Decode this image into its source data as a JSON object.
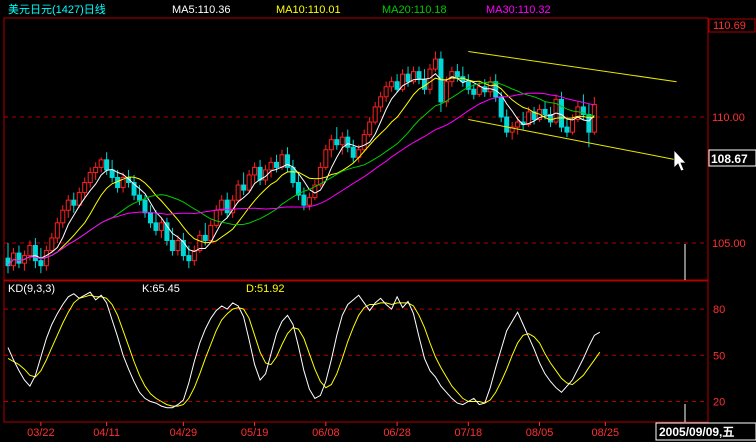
{
  "chart_data": {
    "type": "candlestick",
    "instrument": "美元日元(1427)日线",
    "moving_averages": [
      {
        "name": "MA5",
        "label": "MA5:110.36",
        "color": "#ffffff"
      },
      {
        "name": "MA10",
        "label": "MA10:110.01",
        "color": "#ffff00"
      },
      {
        "name": "MA20",
        "label": "MA20:110.18",
        "color": "#00cc00"
      },
      {
        "name": "MA30",
        "label": "MA30:110.32",
        "color": "#ff00ff"
      }
    ],
    "price_axis": {
      "range": [
        103.2,
        111.2
      ],
      "ticks": [
        "105.00",
        "110.00"
      ],
      "tick_values": [
        105,
        110
      ],
      "max_label": "110.69",
      "current_label": "108.67"
    },
    "candles": [
      {
        "o": 104.4,
        "h": 105.0,
        "l": 103.8,
        "c": 104.1
      },
      {
        "o": 104.1,
        "h": 104.8,
        "l": 103.9,
        "c": 104.6
      },
      {
        "o": 104.6,
        "h": 104.9,
        "l": 104.0,
        "c": 104.2
      },
      {
        "o": 104.2,
        "h": 104.7,
        "l": 103.9,
        "c": 104.5
      },
      {
        "o": 104.5,
        "h": 105.1,
        "l": 104.3,
        "c": 104.9
      },
      {
        "o": 104.9,
        "h": 105.2,
        "l": 104.0,
        "c": 104.3
      },
      {
        "o": 104.3,
        "h": 104.8,
        "l": 103.8,
        "c": 104.1
      },
      {
        "o": 104.1,
        "h": 104.9,
        "l": 103.9,
        "c": 104.7
      },
      {
        "o": 104.7,
        "h": 105.4,
        "l": 104.6,
        "c": 105.2
      },
      {
        "o": 105.2,
        "h": 106.0,
        "l": 105.0,
        "c": 105.8
      },
      {
        "o": 105.8,
        "h": 106.5,
        "l": 105.6,
        "c": 106.3
      },
      {
        "o": 106.3,
        "h": 106.9,
        "l": 106.0,
        "c": 106.7
      },
      {
        "o": 106.7,
        "h": 107.0,
        "l": 106.2,
        "c": 106.5
      },
      {
        "o": 106.5,
        "h": 107.2,
        "l": 106.4,
        "c": 107.0
      },
      {
        "o": 107.0,
        "h": 107.6,
        "l": 106.8,
        "c": 107.4
      },
      {
        "o": 107.4,
        "h": 108.0,
        "l": 107.2,
        "c": 107.8
      },
      {
        "o": 107.8,
        "h": 108.2,
        "l": 107.5,
        "c": 108.0
      },
      {
        "o": 108.0,
        "h": 108.4,
        "l": 107.8,
        "c": 108.3
      },
      {
        "o": 108.3,
        "h": 108.6,
        "l": 107.7,
        "c": 107.9
      },
      {
        "o": 107.9,
        "h": 108.3,
        "l": 107.4,
        "c": 107.6
      },
      {
        "o": 107.6,
        "h": 107.9,
        "l": 107.0,
        "c": 107.2
      },
      {
        "o": 107.2,
        "h": 107.8,
        "l": 107.0,
        "c": 107.6
      },
      {
        "o": 107.6,
        "h": 107.9,
        "l": 107.2,
        "c": 107.4
      },
      {
        "o": 107.4,
        "h": 107.7,
        "l": 106.7,
        "c": 106.9
      },
      {
        "o": 106.9,
        "h": 107.3,
        "l": 106.5,
        "c": 106.7
      },
      {
        "o": 106.7,
        "h": 106.9,
        "l": 106.0,
        "c": 106.2
      },
      {
        "o": 106.2,
        "h": 106.5,
        "l": 105.6,
        "c": 105.8
      },
      {
        "o": 105.8,
        "h": 106.3,
        "l": 105.3,
        "c": 105.5
      },
      {
        "o": 105.5,
        "h": 106.0,
        "l": 105.2,
        "c": 105.8
      },
      {
        "o": 105.8,
        "h": 106.0,
        "l": 104.9,
        "c": 105.1
      },
      {
        "o": 105.1,
        "h": 105.6,
        "l": 104.5,
        "c": 104.7
      },
      {
        "o": 104.7,
        "h": 105.3,
        "l": 104.5,
        "c": 105.1
      },
      {
        "o": 105.1,
        "h": 105.4,
        "l": 104.3,
        "c": 104.5
      },
      {
        "o": 104.5,
        "h": 104.9,
        "l": 104.0,
        "c": 104.3
      },
      {
        "o": 104.3,
        "h": 104.9,
        "l": 104.1,
        "c": 104.7
      },
      {
        "o": 104.7,
        "h": 105.5,
        "l": 104.6,
        "c": 105.3
      },
      {
        "o": 105.3,
        "h": 105.8,
        "l": 104.9,
        "c": 105.1
      },
      {
        "o": 105.1,
        "h": 105.9,
        "l": 105.0,
        "c": 105.7
      },
      {
        "o": 105.7,
        "h": 106.5,
        "l": 105.6,
        "c": 106.3
      },
      {
        "o": 106.3,
        "h": 106.9,
        "l": 106.1,
        "c": 106.7
      },
      {
        "o": 106.7,
        "h": 107.0,
        "l": 106.0,
        "c": 106.2
      },
      {
        "o": 106.2,
        "h": 106.9,
        "l": 106.0,
        "c": 106.7
      },
      {
        "o": 106.7,
        "h": 107.5,
        "l": 106.6,
        "c": 107.3
      },
      {
        "o": 107.3,
        "h": 107.8,
        "l": 106.9,
        "c": 107.1
      },
      {
        "o": 107.1,
        "h": 107.9,
        "l": 107.0,
        "c": 107.7
      },
      {
        "o": 107.7,
        "h": 108.2,
        "l": 107.4,
        "c": 108.0
      },
      {
        "o": 108.0,
        "h": 108.3,
        "l": 107.3,
        "c": 107.5
      },
      {
        "o": 107.5,
        "h": 108.1,
        "l": 107.3,
        "c": 107.9
      },
      {
        "o": 107.9,
        "h": 108.4,
        "l": 107.6,
        "c": 108.2
      },
      {
        "o": 108.2,
        "h": 108.5,
        "l": 107.8,
        "c": 108.0
      },
      {
        "o": 108.0,
        "h": 108.7,
        "l": 107.9,
        "c": 108.5
      },
      {
        "o": 108.5,
        "h": 108.8,
        "l": 107.8,
        "c": 108.0
      },
      {
        "o": 108.0,
        "h": 108.3,
        "l": 107.2,
        "c": 107.4
      },
      {
        "o": 107.4,
        "h": 107.8,
        "l": 106.7,
        "c": 106.9
      },
      {
        "o": 106.9,
        "h": 107.2,
        "l": 106.3,
        "c": 106.5
      },
      {
        "o": 106.5,
        "h": 107.0,
        "l": 106.3,
        "c": 106.8
      },
      {
        "o": 106.8,
        "h": 107.5,
        "l": 106.7,
        "c": 107.3
      },
      {
        "o": 107.3,
        "h": 108.2,
        "l": 107.2,
        "c": 108.0
      },
      {
        "o": 108.0,
        "h": 108.9,
        "l": 107.9,
        "c": 108.7
      },
      {
        "o": 108.7,
        "h": 109.3,
        "l": 108.4,
        "c": 109.1
      },
      {
        "o": 109.1,
        "h": 109.6,
        "l": 108.7,
        "c": 108.9
      },
      {
        "o": 108.9,
        "h": 109.4,
        "l": 108.5,
        "c": 109.2
      },
      {
        "o": 109.2,
        "h": 109.5,
        "l": 108.6,
        "c": 108.8
      },
      {
        "o": 108.8,
        "h": 109.1,
        "l": 108.2,
        "c": 108.4
      },
      {
        "o": 108.4,
        "h": 108.9,
        "l": 108.2,
        "c": 108.7
      },
      {
        "o": 108.7,
        "h": 109.5,
        "l": 108.6,
        "c": 109.3
      },
      {
        "o": 109.3,
        "h": 110.0,
        "l": 109.2,
        "c": 109.8
      },
      {
        "o": 109.8,
        "h": 110.6,
        "l": 109.7,
        "c": 110.4
      },
      {
        "o": 110.4,
        "h": 111.0,
        "l": 110.2,
        "c": 110.8
      },
      {
        "o": 110.8,
        "h": 111.4,
        "l": 110.6,
        "c": 111.2
      },
      {
        "o": 111.2,
        "h": 111.6,
        "l": 111.0,
        "c": 111.4
      },
      {
        "o": 111.4,
        "h": 111.7,
        "l": 111.0,
        "c": 111.1
      },
      {
        "o": 111.1,
        "h": 111.9,
        "l": 111.0,
        "c": 111.7
      },
      {
        "o": 111.7,
        "h": 112.0,
        "l": 111.2,
        "c": 111.4
      },
      {
        "o": 111.4,
        "h": 112.0,
        "l": 111.3,
        "c": 111.8
      },
      {
        "o": 111.8,
        "h": 112.0,
        "l": 111.3,
        "c": 111.5
      },
      {
        "o": 111.5,
        "h": 111.9,
        "l": 110.9,
        "c": 111.1
      },
      {
        "o": 111.1,
        "h": 112.1,
        "l": 110.9,
        "c": 111.9
      },
      {
        "o": 111.9,
        "h": 112.6,
        "l": 111.8,
        "c": 112.3
      },
      {
        "o": 112.3,
        "h": 112.6,
        "l": 110.2,
        "c": 110.6
      },
      {
        "o": 110.6,
        "h": 111.6,
        "l": 110.4,
        "c": 111.4
      },
      {
        "o": 111.4,
        "h": 112.0,
        "l": 111.2,
        "c": 111.8
      },
      {
        "o": 111.8,
        "h": 112.1,
        "l": 111.4,
        "c": 111.6
      },
      {
        "o": 111.6,
        "h": 112.0,
        "l": 111.2,
        "c": 111.4
      },
      {
        "o": 111.4,
        "h": 111.7,
        "l": 110.9,
        "c": 111.1
      },
      {
        "o": 111.1,
        "h": 111.3,
        "l": 110.7,
        "c": 110.9
      },
      {
        "o": 110.9,
        "h": 111.4,
        "l": 110.8,
        "c": 111.2
      },
      {
        "o": 111.2,
        "h": 111.5,
        "l": 110.8,
        "c": 111.0
      },
      {
        "o": 111.0,
        "h": 111.6,
        "l": 110.8,
        "c": 111.4
      },
      {
        "o": 111.4,
        "h": 111.7,
        "l": 110.6,
        "c": 110.8
      },
      {
        "o": 110.8,
        "h": 111.0,
        "l": 109.8,
        "c": 110.0
      },
      {
        "o": 110.0,
        "h": 110.3,
        "l": 109.2,
        "c": 109.4
      },
      {
        "o": 109.4,
        "h": 109.8,
        "l": 109.1,
        "c": 109.6
      },
      {
        "o": 109.6,
        "h": 110.0,
        "l": 109.3,
        "c": 109.8
      },
      {
        "o": 109.8,
        "h": 110.2,
        "l": 109.5,
        "c": 109.7
      },
      {
        "o": 109.7,
        "h": 110.4,
        "l": 109.6,
        "c": 110.2
      },
      {
        "o": 110.2,
        "h": 110.4,
        "l": 109.7,
        "c": 109.9
      },
      {
        "o": 109.9,
        "h": 110.5,
        "l": 109.8,
        "c": 110.3
      },
      {
        "o": 110.3,
        "h": 110.6,
        "l": 109.9,
        "c": 110.1
      },
      {
        "o": 110.1,
        "h": 110.4,
        "l": 109.6,
        "c": 109.8
      },
      {
        "o": 109.8,
        "h": 110.9,
        "l": 109.7,
        "c": 110.7
      },
      {
        "o": 110.7,
        "h": 111.0,
        "l": 109.4,
        "c": 109.6
      },
      {
        "o": 109.6,
        "h": 109.9,
        "l": 109.2,
        "c": 109.4
      },
      {
        "o": 109.4,
        "h": 110.1,
        "l": 109.3,
        "c": 109.9
      },
      {
        "o": 109.9,
        "h": 110.6,
        "l": 109.8,
        "c": 110.4
      },
      {
        "o": 110.4,
        "h": 110.9,
        "l": 109.9,
        "c": 110.1
      },
      {
        "o": 110.1,
        "h": 110.5,
        "l": 108.8,
        "c": 109.4
      },
      {
        "o": 109.4,
        "h": 110.8,
        "l": 109.3,
        "c": 110.5
      }
    ],
    "kd": {
      "title": "KD(9,3,3)",
      "k_label": "K:65.45",
      "d_label": "D:51.92",
      "k_color": "#ffffff",
      "d_color": "#ffff00",
      "range": [
        8,
        95
      ],
      "ticks": [
        "80",
        "50",
        "20"
      ],
      "tick_values": [
        80,
        50,
        20
      ],
      "k": [
        55,
        47,
        40,
        34,
        30,
        37,
        49,
        61,
        70,
        77,
        83,
        88,
        90,
        87,
        89,
        91,
        86,
        89,
        84,
        73,
        62,
        50,
        41,
        33,
        26,
        22,
        20,
        19,
        17,
        16,
        16,
        18,
        21,
        32,
        46,
        58,
        67,
        74,
        79,
        82,
        80,
        84,
        82,
        75,
        60,
        44,
        34,
        38,
        51,
        64,
        72,
        76,
        70,
        56,
        40,
        28,
        22,
        24,
        33,
        47,
        63,
        76,
        83,
        86,
        89,
        84,
        79,
        84,
        87,
        83,
        80,
        88,
        81,
        85,
        77,
        62,
        48,
        40,
        36,
        30,
        26,
        22,
        19,
        18,
        20,
        22,
        18,
        19,
        29,
        42,
        54,
        66,
        72,
        78,
        70,
        62,
        54,
        45,
        38,
        33,
        29,
        26,
        30,
        34,
        41,
        48,
        56,
        63,
        65
      ],
      "d": [
        48,
        46,
        44,
        41,
        37,
        36,
        40,
        47,
        55,
        63,
        71,
        78,
        84,
        87,
        88,
        89,
        88,
        88,
        87,
        83,
        76,
        66,
        56,
        46,
        37,
        30,
        25,
        22,
        20,
        18,
        17,
        17,
        18,
        22,
        29,
        38,
        48,
        57,
        66,
        73,
        77,
        80,
        81,
        80,
        74,
        63,
        52,
        45,
        44,
        49,
        57,
        64,
        68,
        67,
        61,
        51,
        41,
        33,
        29,
        31,
        38,
        48,
        59,
        68,
        76,
        81,
        83,
        83,
        84,
        84,
        83,
        84,
        84,
        84,
        82,
        76,
        68,
        58,
        49,
        42,
        36,
        30,
        26,
        22,
        20,
        20,
        20,
        19,
        21,
        26,
        33,
        41,
        50,
        58,
        63,
        64,
        62,
        58,
        51,
        45,
        40,
        35,
        32,
        31,
        34,
        37,
        42,
        47,
        52
      ]
    },
    "x_axis": {
      "labels": [
        "03/22",
        "04/11",
        "04/29",
        "05/19",
        "06/08",
        "06/28",
        "07/18",
        "08/05",
        "08/25"
      ],
      "label_index": [
        6,
        18,
        32,
        45,
        58,
        71,
        84,
        97,
        109
      ],
      "current_date": "2005/09/09,五"
    },
    "trend_channel": {
      "upper": [
        {
          "i": 84,
          "p": 112.6
        },
        {
          "i": 122,
          "p": 111.4
        }
      ],
      "lower": [
        {
          "i": 84,
          "p": 109.9
        },
        {
          "i": 122,
          "p": 108.3
        }
      ]
    }
  }
}
